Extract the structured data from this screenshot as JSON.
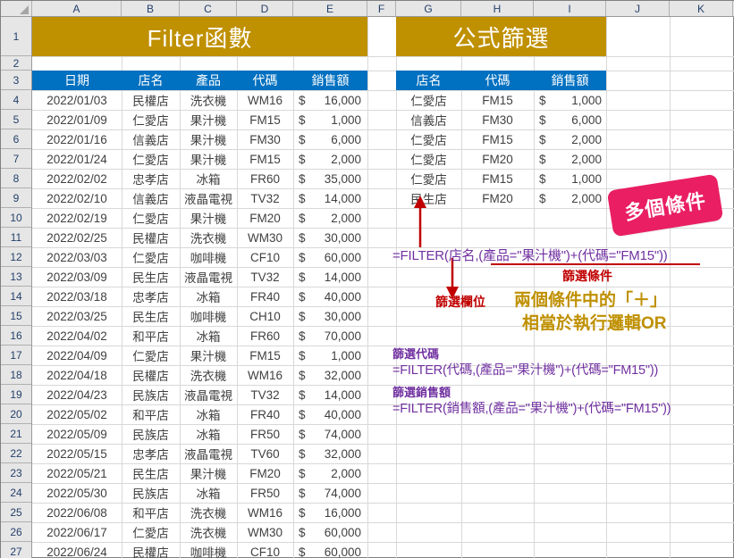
{
  "spreadsheet": {
    "column_headers": [
      "A",
      "B",
      "C",
      "D",
      "E",
      "F",
      "G",
      "H",
      "I",
      "J",
      "K"
    ],
    "row_headers": [
      "1",
      "2",
      "3",
      "4",
      "5",
      "6",
      "7",
      "8",
      "9",
      "10",
      "11",
      "12",
      "13",
      "14",
      "15",
      "16",
      "17",
      "18",
      "19",
      "20",
      "21",
      "22",
      "23",
      "24",
      "25",
      "26",
      "27"
    ]
  },
  "colors": {
    "banner_gold": "#BF9000",
    "table_header_blue": "#0070C0",
    "badge_pink": "#E91E63",
    "formula_purple": "#7030A0",
    "annotation_red": "#C00000",
    "gold_text": "#BF9000"
  },
  "left_panel": {
    "banner_title": "Filter函數",
    "headers": [
      "日期",
      "店名",
      "產品",
      "代碼",
      "銷售額"
    ],
    "rows": [
      {
        "date": "2022/01/03",
        "store": "民權店",
        "product": "洗衣機",
        "code": "WM16",
        "amount": "16,000"
      },
      {
        "date": "2022/01/09",
        "store": "仁愛店",
        "product": "果汁機",
        "code": "FM15",
        "amount": "1,000"
      },
      {
        "date": "2022/01/16",
        "store": "信義店",
        "product": "果汁機",
        "code": "FM30",
        "amount": "6,000"
      },
      {
        "date": "2022/01/24",
        "store": "仁愛店",
        "product": "果汁機",
        "code": "FM15",
        "amount": "2,000"
      },
      {
        "date": "2022/02/02",
        "store": "忠孝店",
        "product": "冰箱",
        "code": "FR60",
        "amount": "35,000"
      },
      {
        "date": "2022/02/10",
        "store": "信義店",
        "product": "液晶電視",
        "code": "TV32",
        "amount": "14,000"
      },
      {
        "date": "2022/02/19",
        "store": "仁愛店",
        "product": "果汁機",
        "code": "FM20",
        "amount": "2,000"
      },
      {
        "date": "2022/02/25",
        "store": "民權店",
        "product": "洗衣機",
        "code": "WM30",
        "amount": "30,000"
      },
      {
        "date": "2022/03/03",
        "store": "仁愛店",
        "product": "咖啡機",
        "code": "CF10",
        "amount": "60,000"
      },
      {
        "date": "2022/03/09",
        "store": "民生店",
        "product": "液晶電視",
        "code": "TV32",
        "amount": "14,000"
      },
      {
        "date": "2022/03/18",
        "store": "忠孝店",
        "product": "冰箱",
        "code": "FR40",
        "amount": "40,000"
      },
      {
        "date": "2022/03/25",
        "store": "民生店",
        "product": "咖啡機",
        "code": "CH10",
        "amount": "30,000"
      },
      {
        "date": "2022/04/02",
        "store": "和平店",
        "product": "冰箱",
        "code": "FR60",
        "amount": "70,000"
      },
      {
        "date": "2022/04/09",
        "store": "仁愛店",
        "product": "果汁機",
        "code": "FM15",
        "amount": "1,000"
      },
      {
        "date": "2022/04/18",
        "store": "民權店",
        "product": "洗衣機",
        "code": "WM16",
        "amount": "32,000"
      },
      {
        "date": "2022/04/23",
        "store": "民族店",
        "product": "液晶電視",
        "code": "TV32",
        "amount": "14,000"
      },
      {
        "date": "2022/05/02",
        "store": "和平店",
        "product": "冰箱",
        "code": "FR40",
        "amount": "40,000"
      },
      {
        "date": "2022/05/09",
        "store": "民族店",
        "product": "冰箱",
        "code": "FR50",
        "amount": "74,000"
      },
      {
        "date": "2022/05/15",
        "store": "忠孝店",
        "product": "液晶電視",
        "code": "TV60",
        "amount": "32,000"
      },
      {
        "date": "2022/05/21",
        "store": "民生店",
        "product": "果汁機",
        "code": "FM20",
        "amount": "2,000"
      },
      {
        "date": "2022/05/30",
        "store": "民族店",
        "product": "冰箱",
        "code": "FR50",
        "amount": "74,000"
      },
      {
        "date": "2022/06/08",
        "store": "和平店",
        "product": "洗衣機",
        "code": "WM16",
        "amount": "16,000"
      },
      {
        "date": "2022/06/17",
        "store": "仁愛店",
        "product": "洗衣機",
        "code": "WM30",
        "amount": "60,000"
      },
      {
        "date": "2022/06/24",
        "store": "民權店",
        "product": "咖啡機",
        "code": "CF10",
        "amount": "60,000"
      }
    ]
  },
  "right_panel": {
    "banner_title": "公式篩選",
    "headers": [
      "店名",
      "代碼",
      "銷售額"
    ],
    "rows": [
      {
        "store": "仁愛店",
        "code": "FM15",
        "amount": "1,000"
      },
      {
        "store": "信義店",
        "code": "FM30",
        "amount": "6,000"
      },
      {
        "store": "仁愛店",
        "code": "FM15",
        "amount": "2,000"
      },
      {
        "store": "仁愛店",
        "code": "FM20",
        "amount": "2,000"
      },
      {
        "store": "仁愛店",
        "code": "FM15",
        "amount": "1,000"
      },
      {
        "store": "民生店",
        "code": "FM20",
        "amount": "2,000"
      }
    ],
    "currency_symbol": "$"
  },
  "annotations": {
    "badge_text": "多個條件",
    "main_formula": "=FILTER(店名,(產品=\"果汁機\")+(代碼=\"FM15\"))",
    "condition_label": "篩選條件",
    "field_label": "篩選欄位",
    "gold_line_1": "兩個條件中的「＋」",
    "gold_line_2": "相當於執行邏輯OR",
    "formula_blocks": [
      {
        "label": "篩選代碼",
        "formula": "=FILTER(代碼,(產品=\"果汁機\")+(代碼=\"FM15\"))"
      },
      {
        "label": "篩選銷售額",
        "formula": "=FILTER(銷售額,(產品=\"果汁機\")+(代碼=\"FM15\"))"
      }
    ]
  }
}
